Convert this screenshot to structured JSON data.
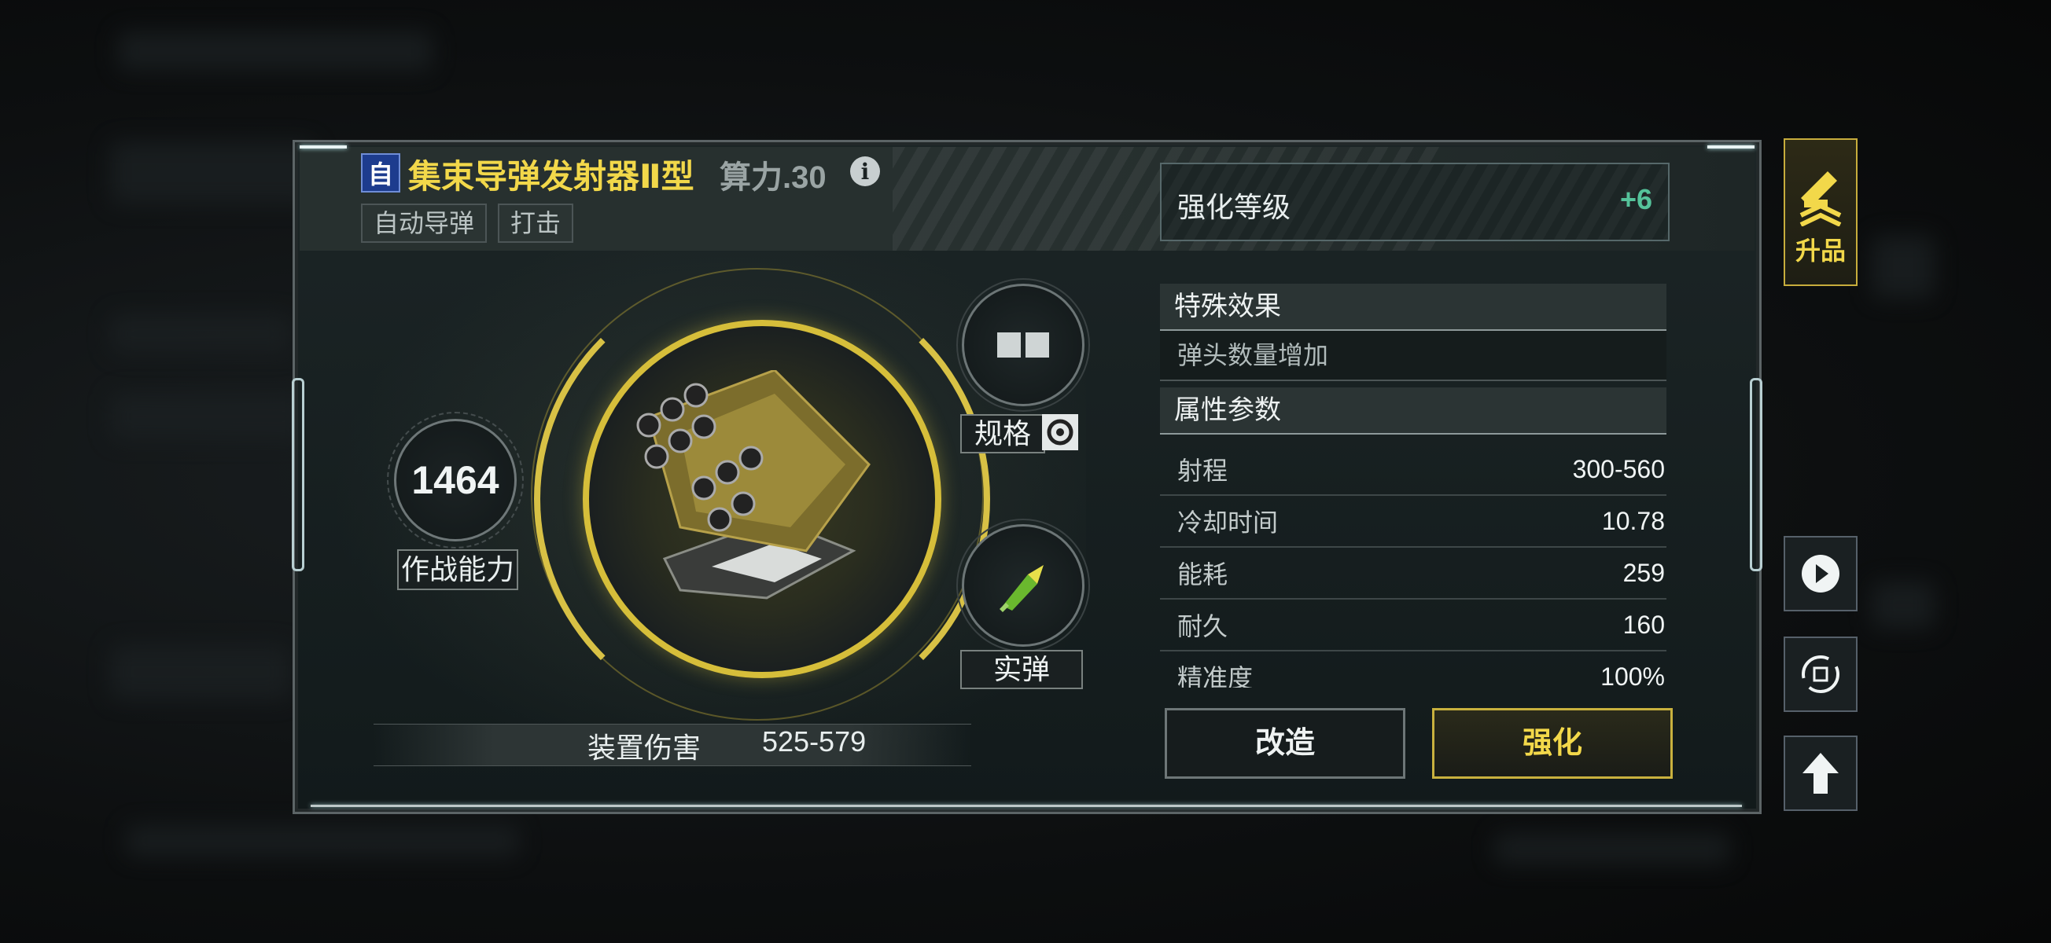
{
  "weapon": {
    "type_badge": "自",
    "name": "集束导弹发射器Ⅱ型",
    "power": "算力.30",
    "tags": [
      "自动导弹",
      "打击"
    ]
  },
  "showcase": {
    "combat_value": "1464",
    "combat_label": "作战能力",
    "spec_label": "规格",
    "ammo_label": "实弹",
    "damage_label": "装置伤害",
    "damage_value": "525-579"
  },
  "enhancement": {
    "label": "强化等级",
    "value": "+6"
  },
  "special_effects": {
    "header": "特殊效果",
    "items": [
      "弹头数量增加"
    ]
  },
  "attributes": {
    "header": "属性参数",
    "rows": [
      {
        "key": "射程",
        "value": "300-560"
      },
      {
        "key": "冷却时间",
        "value": "10.78"
      },
      {
        "key": "能耗",
        "value": "259"
      },
      {
        "key": "耐久",
        "value": "160"
      },
      {
        "key": "精准度",
        "value": "100%"
      }
    ]
  },
  "buttons": {
    "modify": "改造",
    "enhance": "强化",
    "upgrade": "升品"
  },
  "colors": {
    "accent_gold": "#f2d84a",
    "positive_green": "#55c29a",
    "badge_blue": "#1d3c8e"
  },
  "icons": {
    "info": "info-icon",
    "refresh": "refresh-icon",
    "play": "play-icon",
    "rotate": "rotate-icon",
    "up_arrow": "up-arrow-icon",
    "upgrade": "cannon-upgrade-icon"
  }
}
